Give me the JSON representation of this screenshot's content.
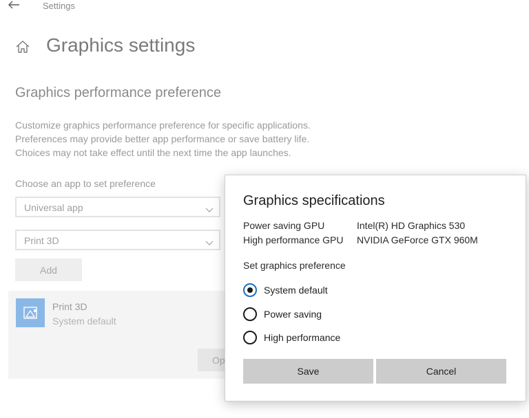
{
  "window": {
    "title": "Settings"
  },
  "page": {
    "title": "Graphics settings",
    "section_title": "Graphics performance preference",
    "description_lines": [
      "Customize graphics performance preference for specific applications.",
      "Preferences may provide better app performance or save battery life.",
      "Choices may not take effect until the next time the app launches."
    ],
    "choose_label": "Choose an app to set preference",
    "app_type_select": {
      "value": "Universal app"
    },
    "app_select": {
      "value": "Print 3D"
    },
    "add_label": "Add",
    "app_list": [
      {
        "name": "Print 3D",
        "preference": "System default"
      }
    ],
    "options_label": "Options"
  },
  "dialog": {
    "title": "Graphics specifications",
    "specs": [
      {
        "key": "Power saving GPU",
        "value": "Intel(R) HD Graphics 530"
      },
      {
        "key": "High performance GPU",
        "value": "NVIDIA GeForce GTX 960M"
      }
    ],
    "preference_label": "Set graphics preference",
    "options": [
      {
        "label": "System default",
        "selected": true
      },
      {
        "label": "Power saving",
        "selected": false
      },
      {
        "label": "High performance",
        "selected": false
      }
    ],
    "save_label": "Save",
    "cancel_label": "Cancel"
  },
  "colors": {
    "accent": "#1a6fc9",
    "app_tile": "#8ab8e6",
    "dialog_button": "#cccccc"
  },
  "icons": {
    "back": "back-arrow-icon",
    "home": "home-icon",
    "chevron": "chevron-down-icon",
    "app": "print-3d-icon"
  }
}
